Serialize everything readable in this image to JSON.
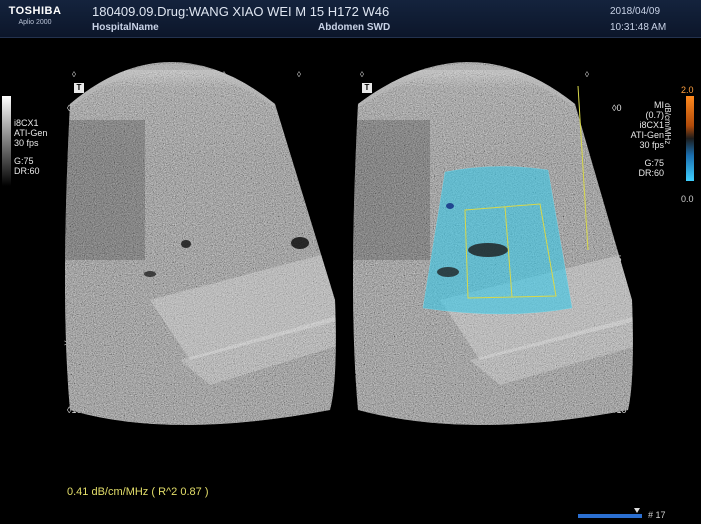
{
  "header": {
    "brand": "TOSHIBA",
    "model": "Aplio 2000",
    "patient_line": "180409.09.Drug:WANG XIAO WEI M 15 H172 W46",
    "hospital": "HospitalName",
    "exam": "Abdomen SWD",
    "date": "2018/04/09",
    "time": "10:31:48 AM"
  },
  "left_panel": {
    "t_label": "T",
    "params": [
      "i8CX1",
      "ATI-Gen",
      "30 fps",
      "",
      "G:75",
      "DR:60"
    ],
    "depth_ticks": [
      "0",
      "5",
      "10"
    ]
  },
  "right_panel": {
    "t_label": "T",
    "params": [
      "MI",
      "(0.7)",
      "i8CX1",
      "ATI-Gen",
      "30 fps",
      "",
      "G:75",
      "DR:60"
    ],
    "depth_ticks": [
      "0",
      "5",
      "10"
    ]
  },
  "color_scale": {
    "max": "2.0",
    "min": "0.0",
    "unit": "dB/cm/MHz"
  },
  "measurement": "0.41 dB/cm/MHz   ( R^2 0.87 )",
  "cine": {
    "frame": "# 17"
  },
  "colors": {
    "header_bg": "#14233d",
    "measure_text": "#e4df6a",
    "roi_yellow": "#d8d84a",
    "ati_overlay": "#3ec8e6",
    "cine_blue": "#2b6fd1"
  }
}
